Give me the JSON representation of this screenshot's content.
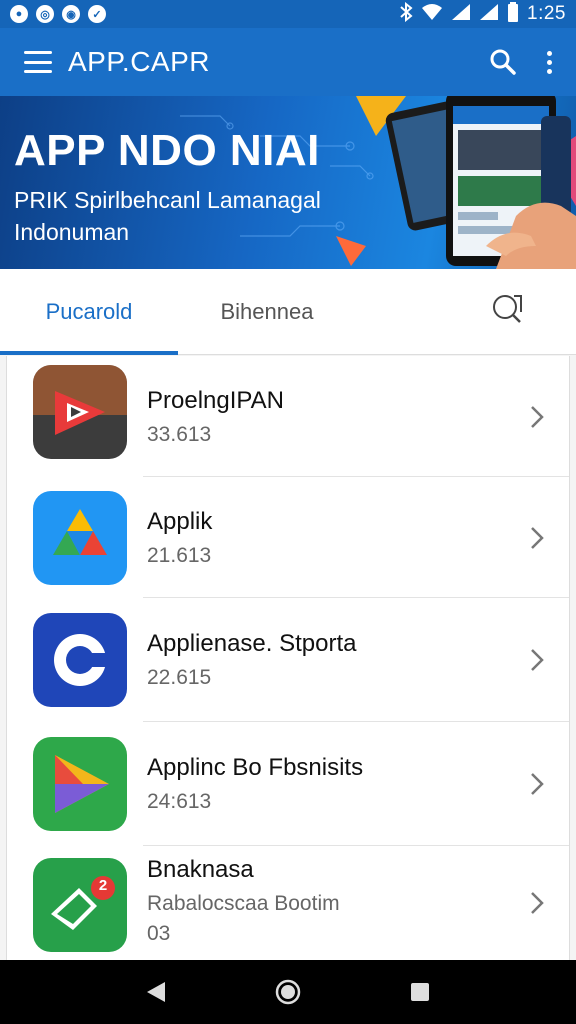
{
  "status_bar": {
    "time": "1:25"
  },
  "app_bar": {
    "title": "APP.CAPR"
  },
  "banner": {
    "title": "APP NDO NIAI",
    "subtitle_line1": "PRIK Spirlbehcanl Lamanagal",
    "subtitle_line2": "Indonuman"
  },
  "tabs": [
    {
      "label": "Pucarold",
      "active": true
    },
    {
      "label": "Bihennea",
      "active": false
    }
  ],
  "apps": [
    {
      "name": "ProelngIPAN",
      "meta": "33.613",
      "icon": "red-play-icon"
    },
    {
      "name": "Applik",
      "meta": "21.613",
      "icon": "drive-triangle-icon"
    },
    {
      "name": "Applienase. Stporta",
      "meta": "22.615",
      "icon": "blue-c-icon"
    },
    {
      "name": "Applinc Bo Fbsnisits",
      "meta": "24:613",
      "icon": "green-play-icon"
    },
    {
      "name": "Bnaknasa",
      "meta": "Rabalocscaa Bootim",
      "meta2": "03",
      "icon": "green-chat-icon",
      "badge": "2"
    }
  ],
  "colors": {
    "primary": "#1a6fc7",
    "status": "#1565b8"
  }
}
